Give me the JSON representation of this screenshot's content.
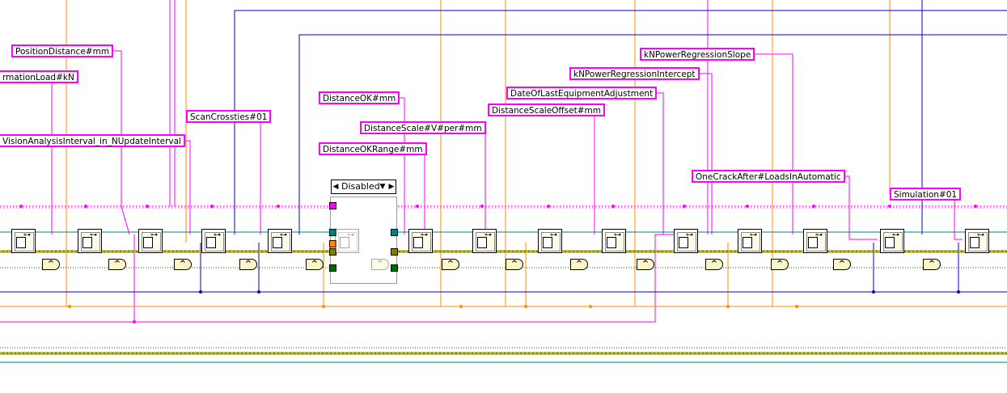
{
  "labels": {
    "position_distance": "PositionDistance#mm",
    "formation_load": "rmationLoad#kN",
    "vision_analysis": "VisionAnalysisInterval_in_NUpdateInterval",
    "scan_crossties": "ScanCrossties#01",
    "distance_ok": "DistanceOK#mm",
    "distance_scale": "DistanceScale#V#per#mm",
    "distance_ok_range": "DistanceOKRange#mm",
    "date_last_adjustment": "DateOfLastEquipmentAdjustment",
    "distance_scale_offset": "DistanceScaleOffset#mm",
    "kn_power_intercept": "kNPowerRegressionIntercept",
    "kn_power_slope": "kNPowerRegressionSlope",
    "one_crack_after": "OneCrackAfter#LoadsInAutomatic",
    "simulation": "Simulation#01"
  },
  "selector": {
    "value": "Disabled",
    "left_arrow": "◀",
    "right_arrow": "▶",
    "dropdown": "▼"
  },
  "and_glyph": "^",
  "key_glyph": "⊶",
  "colors": {
    "pink_wire": "#ff00ff",
    "orange_wire": "#ff8c00",
    "blue_wire": "#0000c0",
    "teal_wire": "#008080",
    "olive_wire": "#808000",
    "green_wire": "#006600"
  }
}
